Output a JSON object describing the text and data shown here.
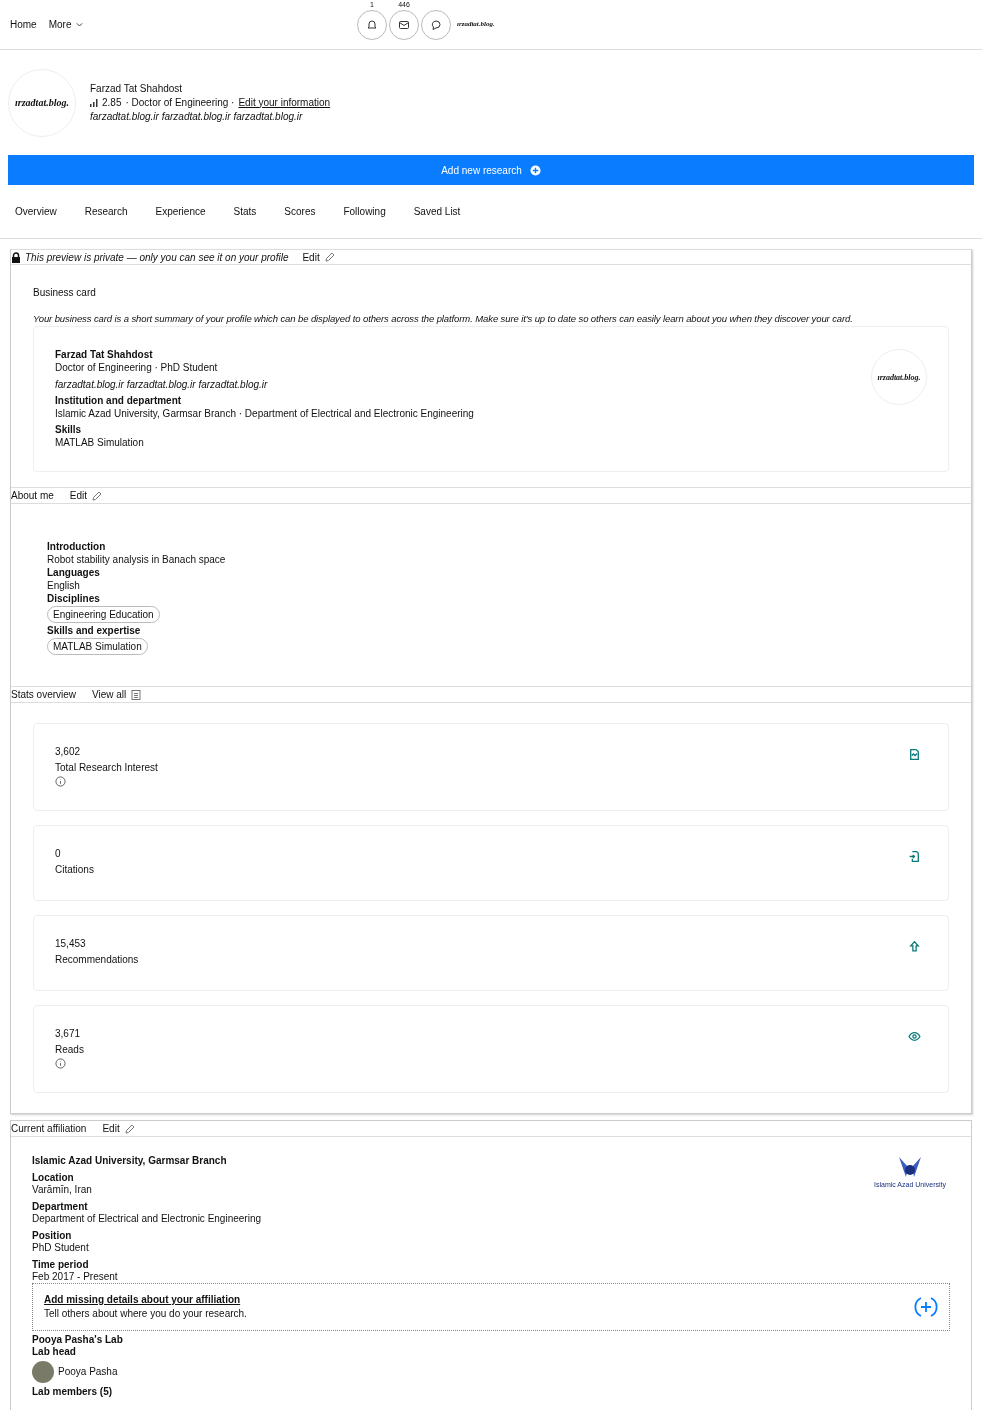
{
  "nav": {
    "links": [
      "Home",
      "More"
    ],
    "icons": [
      {
        "kind": "bell",
        "count": "1"
      },
      {
        "kind": "mail",
        "count": "446"
      },
      {
        "kind": "chat"
      }
    ],
    "logo_text": "ırzadtat.blog."
  },
  "profile": {
    "logo_text": "ırzadtat.blog.",
    "name": "Farzad Tat Shahdost",
    "score": "2.85",
    "degree": "· Doctor of Engineering ·",
    "edit_link": "Edit your information",
    "website": "farzadtat.blog.ir farzadtat.blog.ir farzadtat.blog.ir"
  },
  "add_button": "Add new research",
  "tabs": [
    {
      "label": "Overview",
      "selected": false
    },
    {
      "label": "Research",
      "selected": false
    },
    {
      "label": "Experience",
      "selected": false
    },
    {
      "label": "Stats",
      "selected": false
    },
    {
      "label": "Scores",
      "selected": false
    },
    {
      "label": "Following",
      "selected": false
    },
    {
      "label": "Saved List",
      "selected": false
    }
  ],
  "preview_bar": {
    "notice": "This preview is private — only you can see it on your profile",
    "edit": "Edit"
  },
  "business_card": {
    "title": "Business card",
    "description": "Your business card is a short summary of your profile which can be displayed to others across the platform. Make sure it's up to date so others can easily learn about you when they discover your card.",
    "name": "Farzad Tat Shahdost",
    "subtitle": "Doctor of Engineering · PhD Student",
    "website": "farzadtat.blog.ir farzadtat.blog.ir farzadtat.blog.ir",
    "logo_text": "ırzadtat.blog.",
    "fields": [
      {
        "label": "Institution and department",
        "value": "Islamic Azad University, Garmsar Branch · Department of Electrical and Electronic Engineering"
      },
      {
        "label": "Skills",
        "value": "MATLAB Simulation"
      }
    ]
  },
  "about": {
    "title": "About me",
    "edit": "Edit",
    "fields": [
      {
        "kind": "text",
        "label": "Introduction",
        "value": "Robot stability analysis in Banach space"
      },
      {
        "kind": "text",
        "label": "Languages",
        "value": "English"
      },
      {
        "kind": "chip",
        "label": "Disciplines",
        "value": "Engineering Education"
      },
      {
        "kind": "chip",
        "label": "Skills and expertise",
        "value": "MATLAB Simulation"
      }
    ]
  },
  "stats": {
    "title": "Stats overview",
    "view_all": "View all",
    "cards": [
      {
        "value": "3,602",
        "label": "Total Research Interest",
        "info": true,
        "kind": "interest"
      },
      {
        "value": "0",
        "label": "Citations",
        "info": false,
        "kind": "citations"
      },
      {
        "value": "15,453",
        "label": "Recommendations",
        "info": false,
        "kind": "recommendations"
      },
      {
        "value": "3,671",
        "label": "Reads",
        "info": true,
        "kind": "reads"
      }
    ]
  },
  "affiliation": {
    "title": "Current affiliation",
    "edit": "Edit",
    "institution": "Islamic Azad University, Garmsar Branch",
    "logo_caption": "Islamic Azad University",
    "fields": [
      {
        "label": "Location",
        "value": "Varāmīn, Iran"
      },
      {
        "label": "Department",
        "value": "Department of Electrical and Electronic Engineering"
      },
      {
        "label": "Position",
        "value": "PhD Student"
      },
      {
        "label": "Time period",
        "value": "Feb 2017 - Present"
      }
    ],
    "prompt": {
      "link": "Add missing details about your affiliation",
      "text": "Tell others about where you do your research."
    },
    "lab": {
      "name": "Pooya Pasha's Lab",
      "head_label": "Lab head",
      "head_name": "Pooya Pasha",
      "members": "Lab members (5)"
    }
  }
}
